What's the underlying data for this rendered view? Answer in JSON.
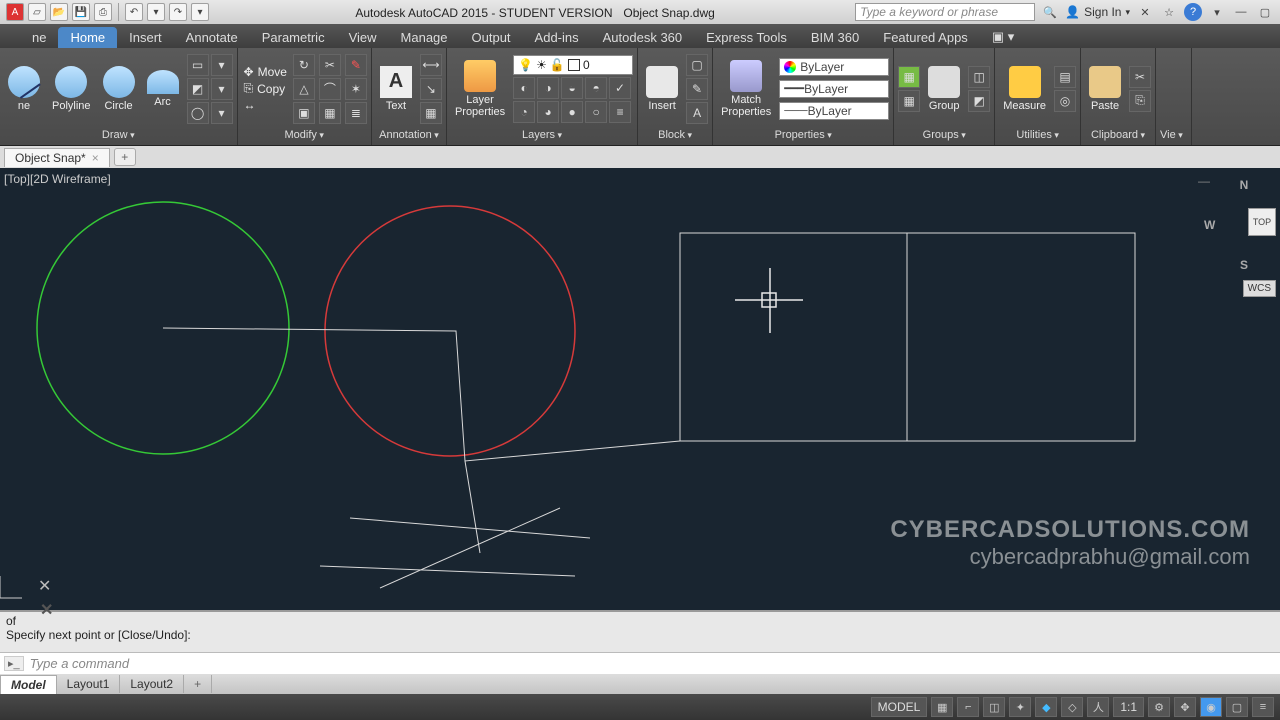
{
  "title": {
    "app": "Autodesk AutoCAD 2015 - STUDENT VERSION",
    "file": "Object Snap.dwg"
  },
  "search": {
    "placeholder": "Type a keyword or phrase"
  },
  "signin": {
    "label": "Sign In"
  },
  "tabs": [
    "Home",
    "Insert",
    "Annotate",
    "Parametric",
    "View",
    "Manage",
    "Output",
    "Add-ins",
    "Autodesk 360",
    "Express Tools",
    "BIM 360",
    "Featured Apps"
  ],
  "ribbon": {
    "draw": {
      "title": "Draw",
      "polyline": "Polyline",
      "circle": "Circle",
      "arc": "Arc"
    },
    "modify": {
      "title": "Modify",
      "move": "Move",
      "copy": "Copy"
    },
    "annotation": {
      "title": "Annotation",
      "text": "Text"
    },
    "layers": {
      "title": "Layers",
      "props": "Layer\nProperties",
      "current": "0"
    },
    "block": {
      "title": "Block",
      "insert": "Insert"
    },
    "properties": {
      "title": "Properties",
      "match": "Match\nProperties",
      "bylayer": "ByLayer"
    },
    "groups": {
      "title": "Groups",
      "group": "Group"
    },
    "utilities": {
      "title": "Utilities",
      "measure": "Measure"
    },
    "clipboard": {
      "title": "Clipboard",
      "paste": "Paste"
    },
    "view": {
      "title": "Vie"
    }
  },
  "filetab": {
    "name": "Object Snap*"
  },
  "viewstyle": "[Top][2D Wireframe]",
  "viewcube": {
    "n": "N",
    "s": "S",
    "w": "W",
    "top": "TOP",
    "wcs": "WCS"
  },
  "watermark": {
    "line1": "CYBERCADSOLUTIONS.COM",
    "line2": "cybercadprabhu@gmail.com"
  },
  "cmdhist": {
    "l1": "of",
    "l2": "Specify next point or [Close/Undo]:"
  },
  "cmdline": {
    "placeholder": "Type a command"
  },
  "layouts": {
    "model": "Model",
    "l1": "Layout1",
    "l2": "Layout2"
  },
  "status": {
    "model": "MODEL",
    "scale": "1:1"
  }
}
